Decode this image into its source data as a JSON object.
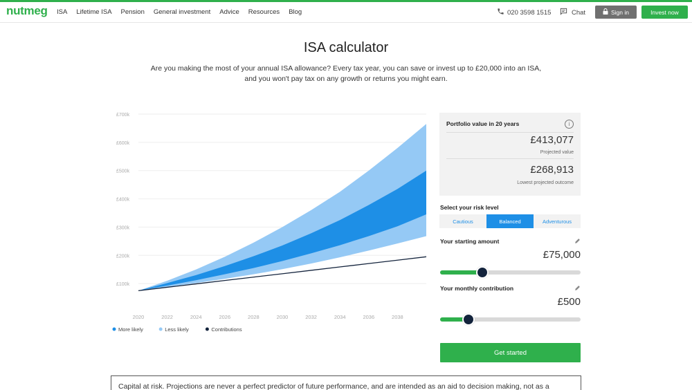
{
  "header": {
    "logo": "nutmeg",
    "nav": [
      "ISA",
      "Lifetime ISA",
      "Pension",
      "General investment",
      "Advice",
      "Resources",
      "Blog"
    ],
    "phone": "020 3598 1515",
    "chat": "Chat",
    "signin": "Sign in",
    "invest": "Invest now",
    "brand_color": "#2fb04c"
  },
  "intro": {
    "title": "ISA calculator",
    "subtitle": "Are you making the most of your annual ISA allowance? Every tax year, you can save or invest up to £20,000 into an ISA, and you won't pay tax on any growth or returns you might earn."
  },
  "chart_data": {
    "type": "area",
    "y_ticks": [
      "£100k",
      "£200k",
      "£300k",
      "£400k",
      "£500k",
      "£600k",
      "£700k"
    ],
    "x_ticks": [
      "2020",
      "2022",
      "2024",
      "2026",
      "2028",
      "2030",
      "2032",
      "2034",
      "2036",
      "2038"
    ],
    "ylim": [
      0,
      700000
    ],
    "xlim": [
      2020,
      2040
    ],
    "x": [
      2020,
      2022,
      2024,
      2026,
      2028,
      2030,
      2032,
      2034,
      2036,
      2038,
      2040
    ],
    "series": [
      {
        "name": "Less likely",
        "role": "upper",
        "color": "#95c9f5",
        "values": [
          75000,
          110000,
          150000,
          195000,
          245000,
          300000,
          360000,
          425000,
          500000,
          580000,
          665000
        ]
      },
      {
        "name": "More likely",
        "role": "upper",
        "color": "#1e8fe6",
        "values": [
          75000,
          102000,
          130000,
          162000,
          197000,
          235000,
          278000,
          325000,
          378000,
          435000,
          500000
        ]
      },
      {
        "name": "More likely",
        "role": "lower",
        "color": "#1e8fe6",
        "values": [
          75000,
          93000,
          112000,
          133000,
          155000,
          180000,
          207000,
          236000,
          268000,
          303000,
          345000
        ]
      },
      {
        "name": "Less likely",
        "role": "lower",
        "color": "#95c9f5",
        "values": [
          75000,
          88000,
          102000,
          117000,
          133000,
          151000,
          171000,
          193000,
          217000,
          242000,
          268000
        ]
      },
      {
        "name": "Contributions",
        "role": "line",
        "color": "#13233c",
        "values": [
          75000,
          87000,
          99000,
          111000,
          123000,
          135000,
          147000,
          159000,
          171000,
          183000,
          195000
        ]
      }
    ],
    "legend": [
      {
        "name": "More likely",
        "color": "#1e8fe6"
      },
      {
        "name": "Less likely",
        "color": "#95c9f5"
      },
      {
        "name": "Contributions",
        "color": "#13233c"
      }
    ],
    "legend_position": "bottom-left",
    "grid": true
  },
  "portfolio": {
    "title": "Portfolio value in 20 years",
    "projected_value": "£413,077",
    "projected_label": "Projected value",
    "lowest_value": "£268,913",
    "lowest_label": "Lowest projected outcome"
  },
  "risk": {
    "label": "Select your risk level",
    "options": [
      "Cautious",
      "Balanced",
      "Adventurous"
    ],
    "selected": "Balanced"
  },
  "starting": {
    "label": "Your starting amount",
    "value": "£75,000",
    "slider_fraction": 0.3
  },
  "monthly": {
    "label": "Your monthly contribution",
    "value": "£500",
    "slider_fraction": 0.2
  },
  "cta": {
    "label": "Get started"
  },
  "disclaimer": {
    "text": "Capital at risk. Projections are never a perfect predictor of future performance, and are intended as an aid to decision making, not as a"
  }
}
